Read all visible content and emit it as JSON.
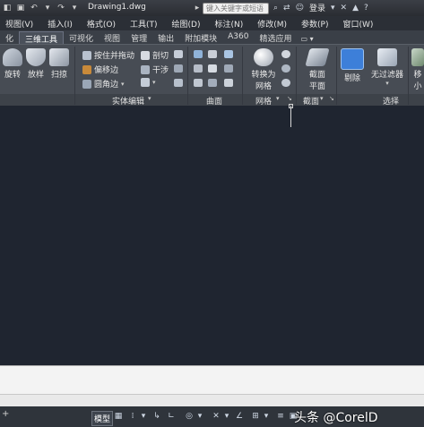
{
  "titlebar": {
    "document_title": "Drawing1.dwg",
    "search_placeholder": "键入关键字或短语",
    "login_label": "登录",
    "quick_access": [
      "open-icon",
      "save-icon",
      "undo-icon",
      "redo-icon"
    ]
  },
  "menubar": {
    "items": [
      "视图(V)",
      "插入(I)",
      "格式(O)",
      "工具(T)",
      "绘图(D)",
      "标注(N)",
      "修改(M)",
      "参数(P)",
      "窗口(W)"
    ]
  },
  "ribbon_tabs": {
    "items": [
      "化",
      "三维工具",
      "可视化",
      "视图",
      "管理",
      "输出",
      "附加模块",
      "A360",
      "精选应用"
    ],
    "active": "三维工具",
    "toggle_label": "▭ ▾"
  },
  "ribbon": {
    "create": {
      "buttons": [
        "旋转",
        "放样",
        "扫掠"
      ]
    },
    "solid_editing": {
      "title": "实体编辑",
      "buttons": [
        "按住并拖动",
        "偏移边",
        "圆角边",
        "剖切",
        "干涉"
      ]
    },
    "surface": {
      "title": "曲面"
    },
    "mesh": {
      "title": "网格",
      "convert_label_line1": "转换为",
      "convert_label_line2": "网格"
    },
    "section": {
      "title": "截面",
      "plane_line1": "截面",
      "plane_line2": "平面"
    },
    "selection": {
      "title": "选择",
      "cull_label": "剔除",
      "no_filter_label": "无过滤器"
    },
    "partial": {
      "line1": "移",
      "line2": "小"
    }
  },
  "statusbar": {
    "plus_tab": "+",
    "model_label": "模型"
  },
  "watermark": {
    "text": "头条 @CorelD"
  },
  "colors": {
    "canvas": "#1f2530",
    "ribbon": "#474c54",
    "accent_blue": "#3d7fd9"
  }
}
